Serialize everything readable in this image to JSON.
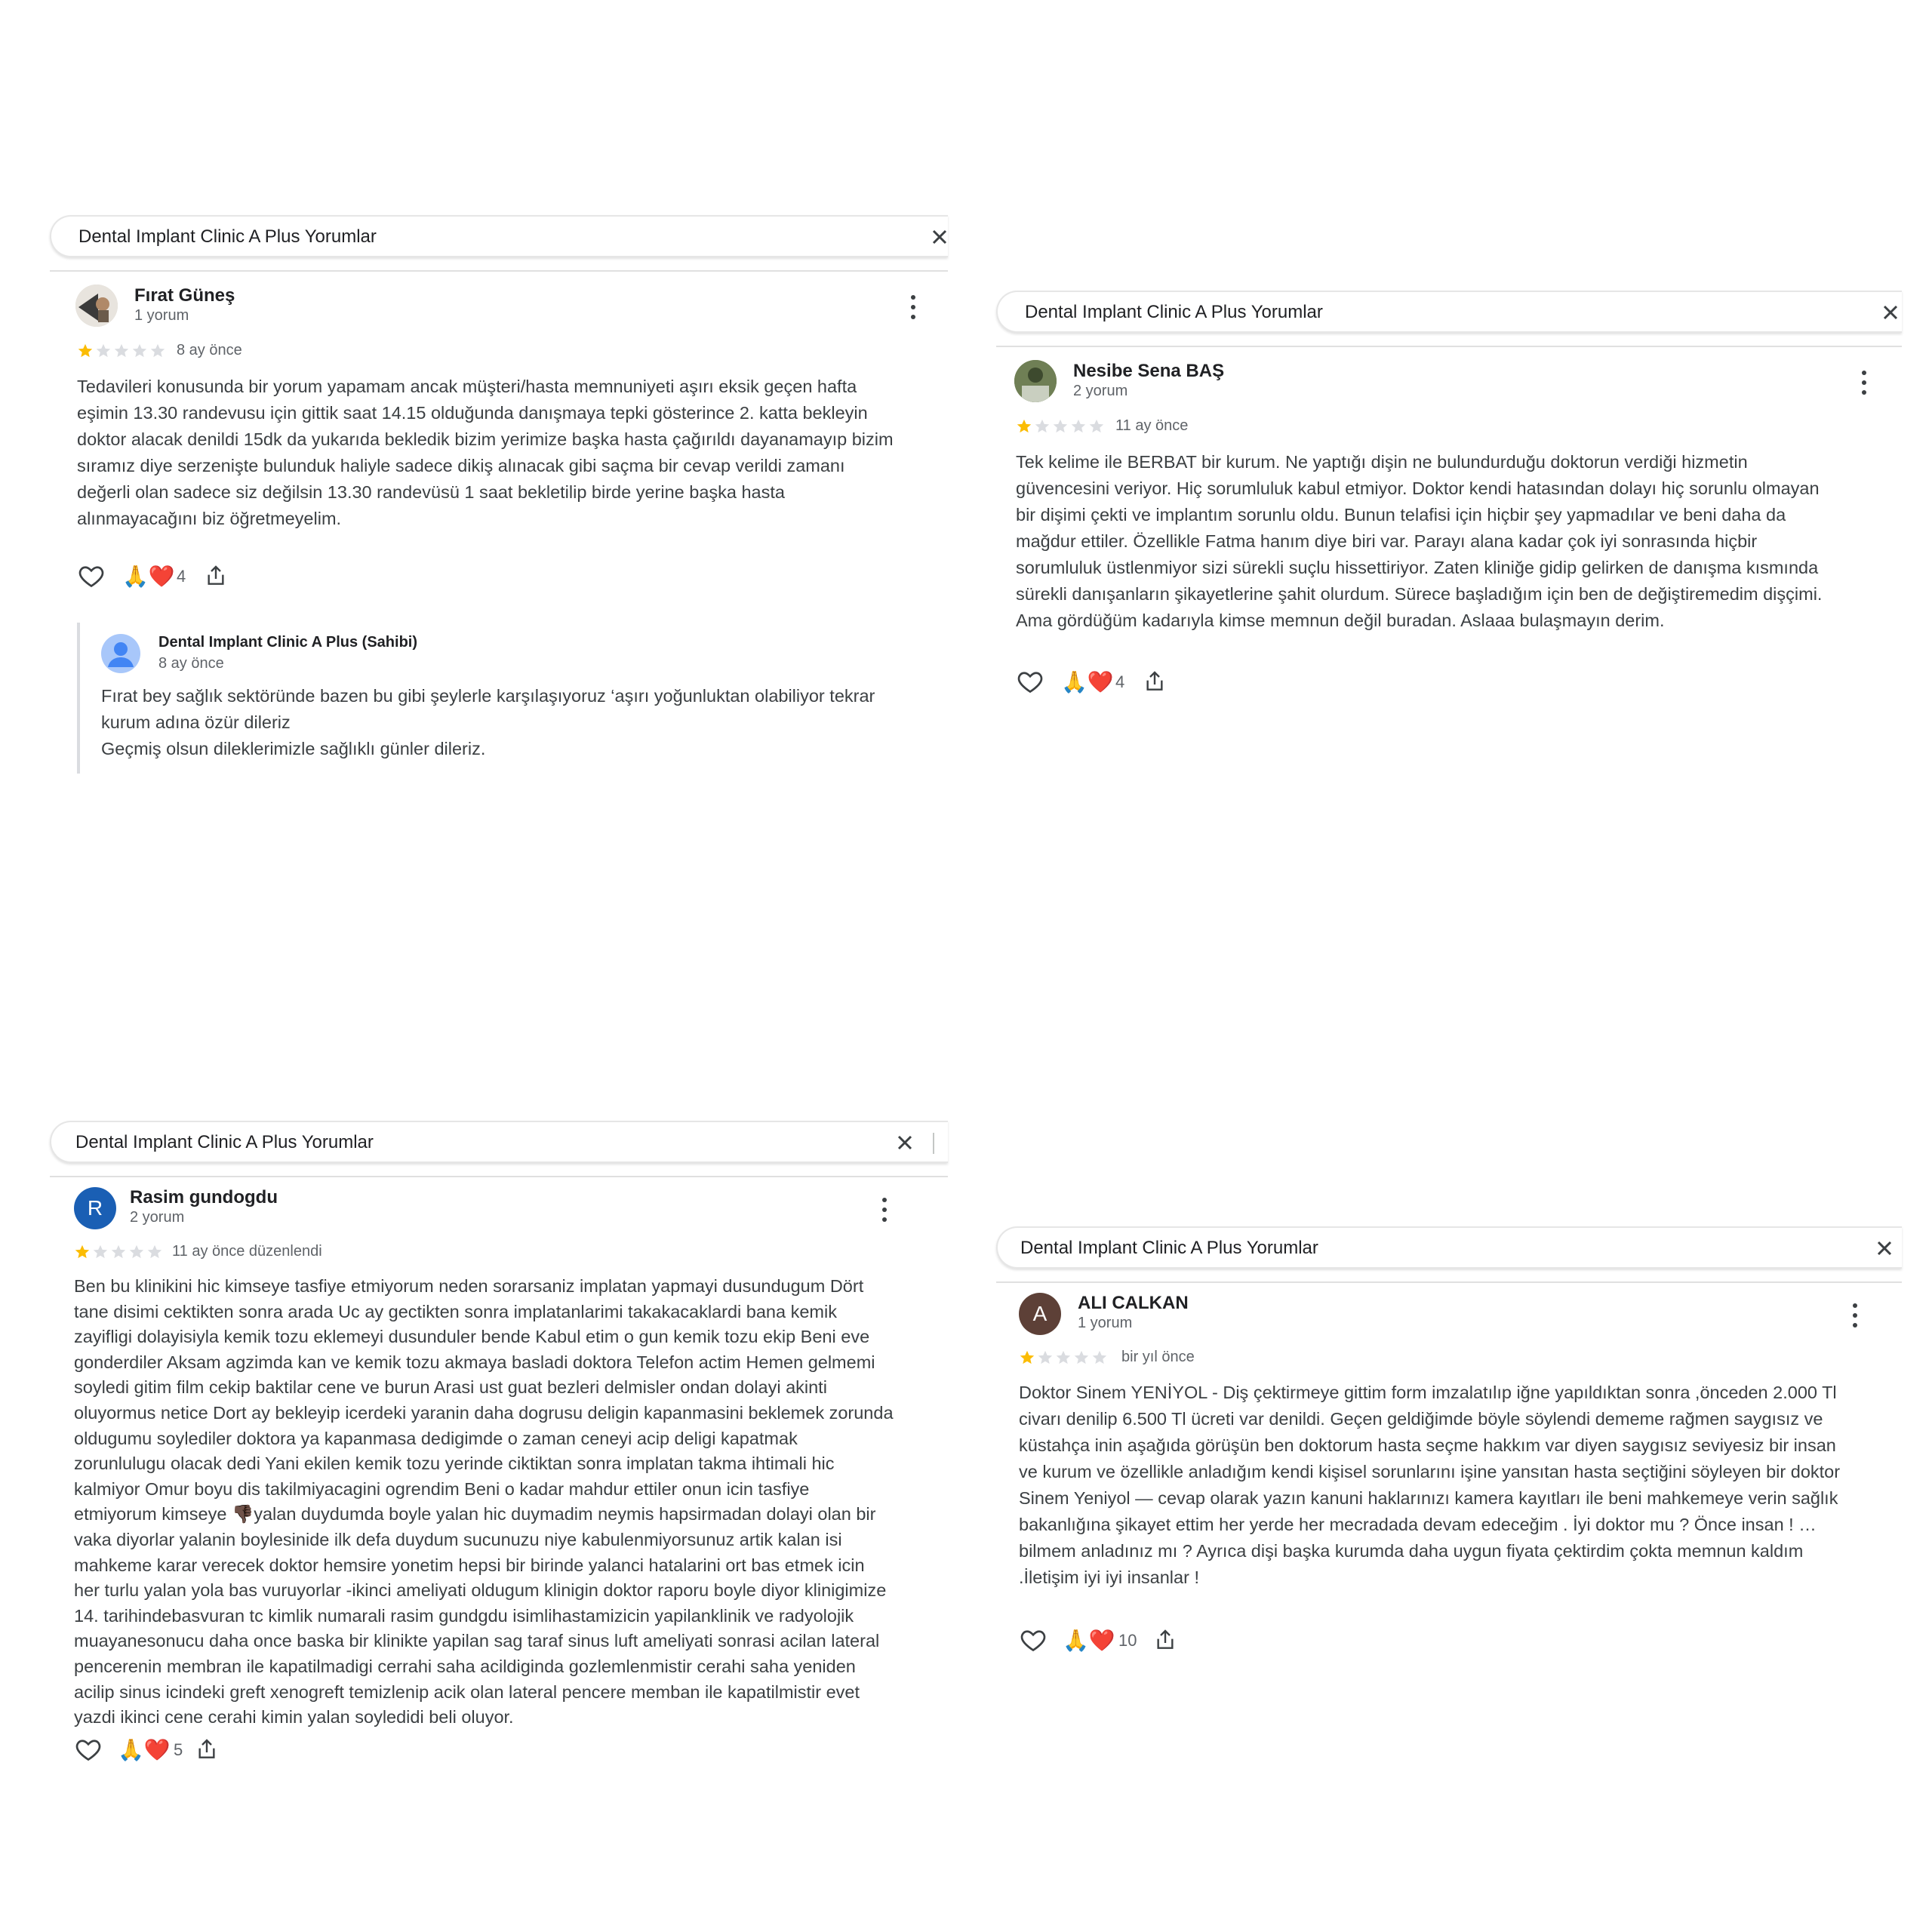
{
  "search_query": "Dental Implant Clinic A Plus Yorumlar",
  "colors": {
    "star_filled": "#fbbc04",
    "star_empty": "#dadce0"
  },
  "reviews": [
    {
      "name": "Fırat Güneş",
      "count": "1 yorum",
      "rating": 1,
      "date": "8 ay önce",
      "text": "Tedavileri konusunda bir yorum yapamam ancak müşteri/hasta memnuniyeti aşırı eksik geçen hafta\neşimin 13.30 randevusu için gittik saat 14.15 olduğunda danışmaya tepki gösterince 2. katta bekleyin\ndoktor alacak denildi 15dk da yukarıda bekledik bizim yerimize başka hasta çağırıldı dayanamayıp bizim\nsıramız diye serzenişte bulunduk haliyle sadece dikiş alınacak gibi saçma bir cevap verildi zamanı\ndeğerli olan sadece siz değilsin 13.30 randevüsü 1 saat bekletilip birde yerine başka hasta\nalınmayacağını biz öğretmeyelim.",
      "reactions": "4",
      "owner_reply": {
        "name": "Dental Implant Clinic A Plus (Sahibi)",
        "date": "8 ay önce",
        "text": "Fırat bey sağlık sektöründe bazen bu gibi şeylerle karşılaşıyoruz ‘aşırı yoğunluktan olabiliyor tekrar\nkurum adına özür dileriz\nGeçmiş olsun dileklerimizle sağlıklı günler dileriz."
      }
    },
    {
      "name": "Nesibe Sena BAŞ",
      "count": "2 yorum",
      "rating": 1,
      "date": "11 ay önce",
      "text": "Tek kelime ile BERBAT bir kurum. Ne yaptığı dişin ne bulundurduğu doktorun verdiği hizmetin\ngüvencesini veriyor. Hiç sorumluluk kabul etmiyor. Doktor kendi hatasından dolayı hiç sorunlu olmayan\nbir dişimi çekti ve implantım sorunlu oldu. Bunun telafisi için hiçbir şey yapmadılar ve beni daha da\nmağdur ettiler. Özellikle Fatma hanım diye biri var. Parayı alana kadar çok iyi sonrasında hiçbir\nsorumluluk üstlenmiyor sizi sürekli suçlu hissettiriyor. Zaten kliniğe gidip gelirken de danışma kısmında\nsürekli danışanların şikayetlerine şahit olurdum. Sürece başladığım için ben de değiştiremedim dişçimi.\nAma gördüğüm kadarıyla kimse memnun değil buradan. Aslaaa bulaşmayın derim.",
      "reactions": "4"
    },
    {
      "name": "Rasim gundogdu",
      "initial": "R",
      "count": "2 yorum",
      "rating": 1,
      "date": "11 ay önce düzenlendi",
      "text_before_emoji": "Ben bu klinikini hic kimseye tasfiye etmiyorum neden sorarsaniz implatan yapmayi dusundugum Dört\ntane disimi cektikten sonra arada Uc ay gectikten sonra implatanlarimi takakacaklardi bana kemik\nzayifligi dolayisiyla kemik tozu eklemeyi dusunduler bende Kabul etim o gun kemik tozu ekip Beni eve\ngonderdiler Aksam agzimda kan ve kemik tozu akmaya basladi doktora Telefon actim Hemen gelmemi\nsoyledi gitim film cekip baktilar cene ve burun Arasi ust guat bezleri delmisler ondan dolayi akinti\noluyormus netice Dort ay bekleyip icerdeki yaranin daha dogrusu deligin kapanmasini beklemek zorunda\noldugumu soylediler doktora ya kapanmasa dedigimde o zaman ceneyi acip deligi kapatmak\nzorunlulugu olacak dedi Yani ekilen kemik tozu yerinde ciktiktan sonra implatan takma ihtimali hic\nkalmiyor Omur boyu dis takilmiyacagini ogrendim Beni o kadar mahdur ettiler onun icin tasfiye\netmiyorum kimseye ",
      "emoji": "👎🏿",
      "text_after_emoji": "yalan duydumda boyle yalan hic duymadim neymis hapsirmadan dolayi olan bir\nvaka diyorlar yalanin boylesinide ilk defa duydum sucunuzu niye kabulenmiyorsunuz artik kalan isi\nmahkeme karar verecek doktor hemsire yonetim hepsi bir birinde yalanci hatalarini ort bas etmek icin\nher turlu yalan yola bas vuruyorlar -ikinci ameliyati oldugum klinigin doktor raporu boyle diyor klinigimize\n14. tarihindebasvuran tc kimlik numarali rasim gundgdu isimlihastamizicin yapilanklinik ve radyolojik\nmuayanesonucu daha once baska bir klinikte yapilan sag taraf sinus luft ameliyati sonrasi acilan lateral\npencerenin membran ile kapatilmadigi cerrahi saha acildiginda gozlemlenmistir cerahi saha yeniden\nacilip sinus icindeki greft xenogreft temizlenip acik olan lateral pencere memban ile kapatilmistir evet\nyazdi ikinci cene cerahi kimin yalan soyledidi beli oluyor.",
      "reactions": "5"
    },
    {
      "name": "ALI CALKAN",
      "initial": "A",
      "count": "1 yorum",
      "rating": 1,
      "date": "bir yıl önce",
      "text": "Doktor Sinem YENİYOL - Diş çektirmeye gittim form imzalatılıp iğne yapıldıktan sonra ,önceden 2.000 Tl\ncivarı denilip 6.500 Tl ücreti var denildi. Geçen geldiğimde böyle söylendi dememe rağmen saygısız ve\nküstahça inin aşağıda görüşün ben doktorum hasta seçme hakkım var diyen saygısız seviyesiz bir insan\nve kurum ve özellikle anladığım kendi kişisel sorunlarını işine yansıtan hasta seçtiğini söyleyen bir doktor\nSinem Yeniyol — cevap olarak yazın kanuni haklarınızı kamera kayıtları ile beni mahkemeye verin sağlık\nbakanlığına şikayet ettim her yerde her mecradada devam edeceğim . İyi doktor mu ? Önce insan ! …\nbilmem anladınız mı ? Ayrıca dişi başka kurumda daha uygun fiyata çektirdim çokta memnun kaldım\n.İletişim iyi iyi insanlar !",
      "reactions": "10"
    }
  ]
}
